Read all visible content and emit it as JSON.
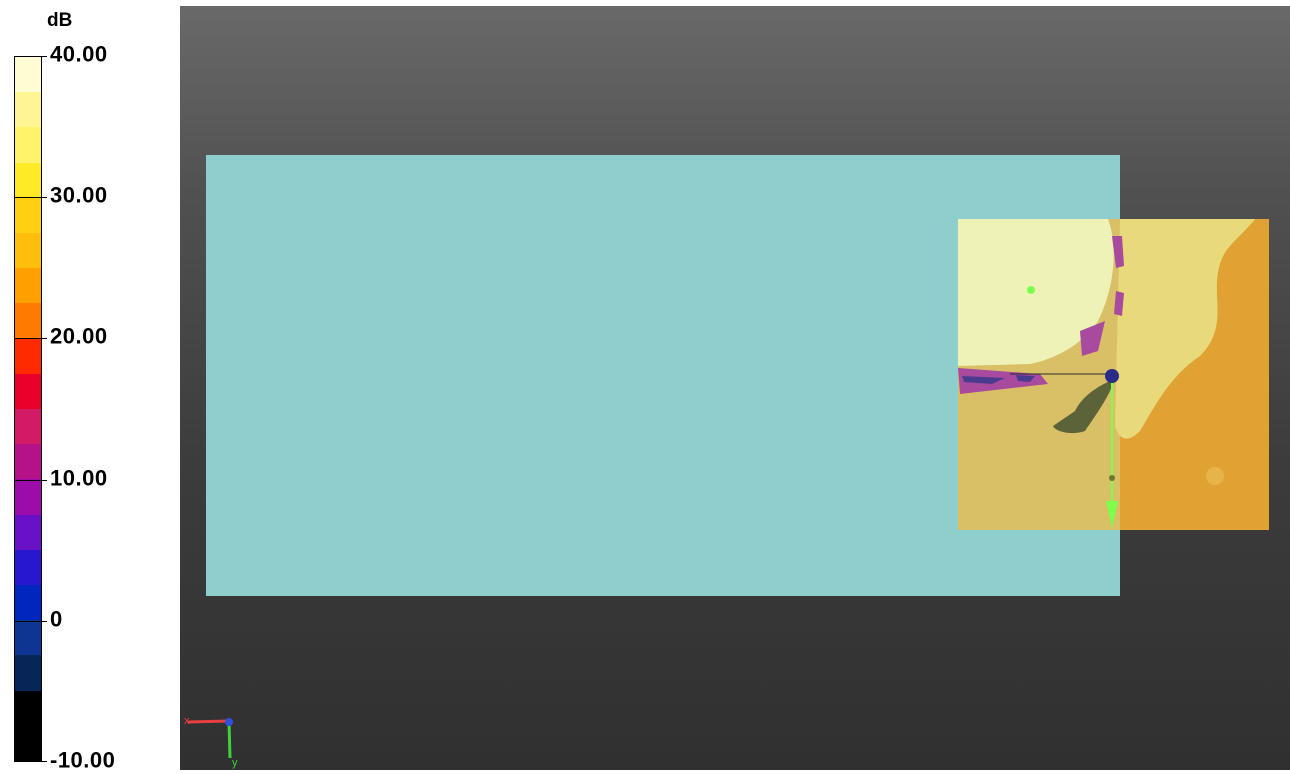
{
  "window": {
    "background": "#ffffff"
  },
  "legend": {
    "unit_label": "dB",
    "range_min": -10,
    "range_max": 40,
    "ticks": [
      {
        "label": "40.00",
        "value": 40
      },
      {
        "label": "30.00",
        "value": 30
      },
      {
        "label": "20.00",
        "value": 20
      },
      {
        "label": "10.00",
        "value": 10
      },
      {
        "label": "0",
        "value": 0
      },
      {
        "label": "-10.00",
        "value": -10
      }
    ],
    "colors": [
      "#fffbd2",
      "#fff594",
      "#fff36b",
      "#ffea27",
      "#ffd012",
      "#ffbe0b",
      "#ff9f00",
      "#ff7a00",
      "#fe2b00",
      "#e9002b",
      "#d11b66",
      "#b51189",
      "#9b0cab",
      "#6911c7",
      "#2718cf",
      "#0026be",
      "#0f3593",
      "#052657",
      "#000000",
      "#000000"
    ]
  },
  "viewport": {
    "background_top": "#696969",
    "background_bottom": "#303030",
    "ground_color": "#8ecfce",
    "field_colors": {
      "high": "#eef2b6",
      "upper": "#e8d97b",
      "mid": "#d9c067",
      "low": "#dfa233",
      "interference": "#a84a9e",
      "interference_dark": "#4a3b8f",
      "shadow": "#5d6338"
    },
    "source_marker": "#2b2b8a",
    "receiver_marker": "#7cff4a",
    "axis_triad": {
      "x_color": "#e84040",
      "y_color": "#40d040",
      "z_color": "#3050e0",
      "x_label": "x",
      "y_label": "y"
    }
  }
}
